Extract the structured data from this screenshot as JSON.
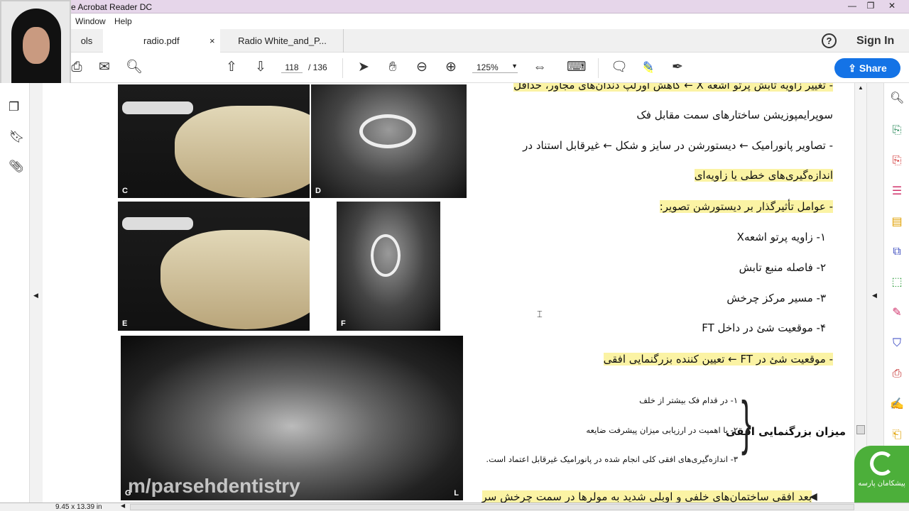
{
  "window": {
    "title": "Adobe Acrobat Reader DC",
    "title_visible": "e Acrobat Reader DC"
  },
  "menu": {
    "items": [
      "Window",
      "Help"
    ]
  },
  "tabs": {
    "tools_partial": "ols",
    "active": "radio.pdf",
    "close": "×",
    "second": "Radio White_and_P..."
  },
  "header": {
    "help": "?",
    "sign_in": "Sign In",
    "share": "Share"
  },
  "toolbar": {
    "page_current": "118",
    "page_total": "/ 136",
    "zoom": "125%"
  },
  "images": {
    "labels": [
      "C",
      "D",
      "E",
      "F",
      "G",
      "L"
    ]
  },
  "document": {
    "lines": [
      {
        "text": "- تغییر زاویه تابش پرتو اشعه X ← کاهش اورلپ دندان‌های مجاور، حداقل",
        "highlight": true
      },
      {
        "text": "سوپرایمپوزیشن ساختارهای سمت مقابل فک",
        "highlight": false
      },
      {
        "text": "- تصاویر پانورامیک ← دیستورشن در سایز و شکل ← غیرقابل استناد در",
        "highlight": false
      },
      {
        "text": "اندازه‌گیری‌های خطی یا زاویه‌ای",
        "highlight": true
      },
      {
        "text": "- عوامل تأثیرگذار بر دیستورشن تصویر:",
        "highlight": true
      },
      {
        "text": "۱- زاویه پرتو اشعهX",
        "highlight": false
      },
      {
        "text": "۲- فاصله منبع تابش",
        "highlight": false
      },
      {
        "text": "۳- مسیر مرکز چرخش",
        "highlight": false
      },
      {
        "text": "۴- موقعیت شئ در داخل FT",
        "highlight": false
      },
      {
        "text": "- موقعیت شئ در FT ← تعیین کننده بزرگنمایی افقی",
        "highlight": true
      }
    ],
    "brace_title": "میزان بزرگنمایی افقی",
    "brace_items": [
      "۱- در قدام فک بیشتر از خلف",
      "۲- با اهمیت در ارزیابی میزان پیشرفت ضایعه",
      "۳- اندازه‌گیری‌های افقی کلی انجام شده در پانورامیک غیرقابل اعتماد است."
    ],
    "bottom_line": "بعد افقی ساختمان‌های خلفی و اوبلی شدید به مولرها در سمت چرخش سر"
  },
  "watermark": "m/parsehdentistry",
  "logo_text": "پیشکامان پارسه",
  "status": {
    "page_size": "9.45 x 13.39 in"
  },
  "colors": {
    "share": "#1473e6",
    "highlight": "#fbf3a4",
    "logo_green": "#4caf3a"
  }
}
